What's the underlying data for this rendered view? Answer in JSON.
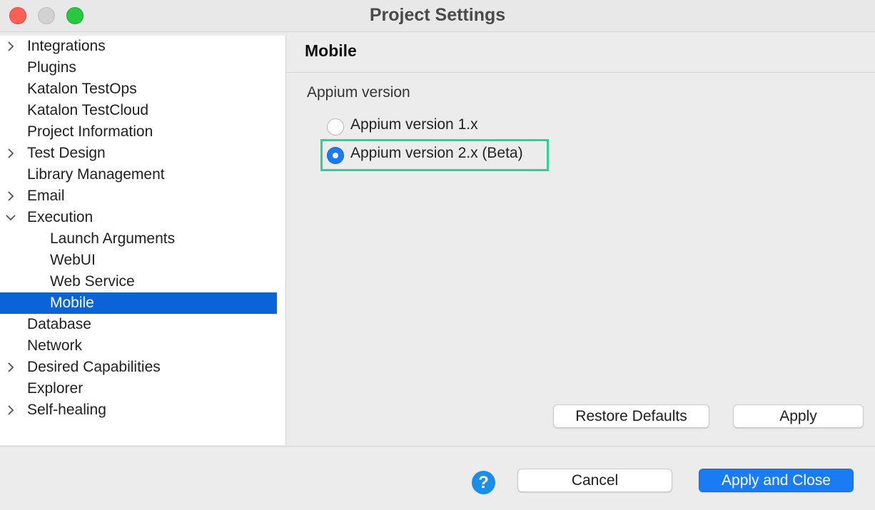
{
  "window": {
    "title": "Project Settings"
  },
  "sidebar": {
    "items": [
      {
        "label": "Integrations",
        "chevron": "right"
      },
      {
        "label": "Plugins",
        "chevron": ""
      },
      {
        "label": "Katalon TestOps",
        "chevron": ""
      },
      {
        "label": "Katalon TestCloud",
        "chevron": ""
      },
      {
        "label": "Project Information",
        "chevron": ""
      },
      {
        "label": "Test Design",
        "chevron": "right"
      },
      {
        "label": "Library Management",
        "chevron": ""
      },
      {
        "label": "Email",
        "chevron": "right"
      },
      {
        "label": "Execution",
        "chevron": "down"
      },
      {
        "label": "Launch Arguments",
        "chevron": ""
      },
      {
        "label": "WebUI",
        "chevron": ""
      },
      {
        "label": "Web Service",
        "chevron": ""
      },
      {
        "label": "Mobile",
        "chevron": "",
        "selected": true
      },
      {
        "label": "Database",
        "chevron": ""
      },
      {
        "label": "Network",
        "chevron": ""
      },
      {
        "label": "Desired Capabilities",
        "chevron": "right"
      },
      {
        "label": "Explorer",
        "chevron": ""
      },
      {
        "label": "Self-healing",
        "chevron": "right"
      }
    ]
  },
  "content": {
    "title": "Mobile",
    "group_label": "Appium version",
    "options": [
      {
        "label": "Appium version 1.x",
        "selected": false
      },
      {
        "label": "Appium version 2.x (Beta)",
        "selected": true
      }
    ],
    "restore_label": "Restore Defaults",
    "apply_label": "Apply"
  },
  "footer": {
    "help_glyph": "?",
    "cancel_label": "Cancel",
    "apply_close_label": "Apply and Close"
  },
  "colors": {
    "selection": "#0a63d8",
    "primary": "#1a7cf5",
    "highlight": "#2ecf9a"
  }
}
